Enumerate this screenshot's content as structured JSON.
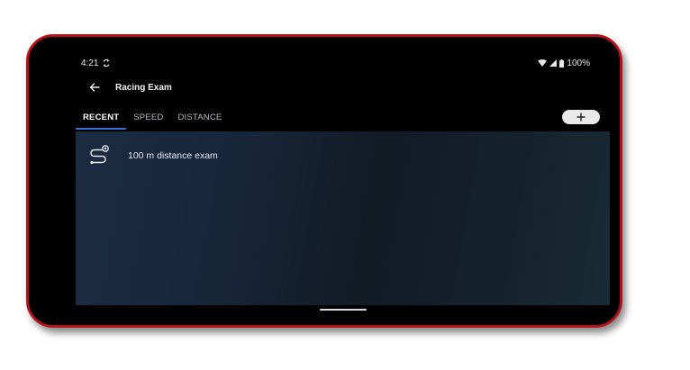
{
  "status_bar": {
    "time": "4:21",
    "battery": "100%",
    "icons": [
      "sync-icon",
      "wifi-icon",
      "cellular-signal-icon",
      "battery-icon"
    ]
  },
  "app_bar": {
    "title": "Racing Exam",
    "back_icon": "back-arrow-icon"
  },
  "tabs": [
    {
      "label": "RECENT",
      "active": true
    },
    {
      "label": "SPEED",
      "active": false
    },
    {
      "label": "DISTANCE",
      "active": false
    }
  ],
  "add_button": {
    "icon": "plus-icon"
  },
  "list": {
    "items": [
      {
        "label": "100 m distance exam",
        "icon": "route-icon"
      }
    ]
  },
  "colors": {
    "frame": "#b3121b",
    "tab_indicator": "#2f6fd6",
    "content_bg": "#1b2b42"
  }
}
